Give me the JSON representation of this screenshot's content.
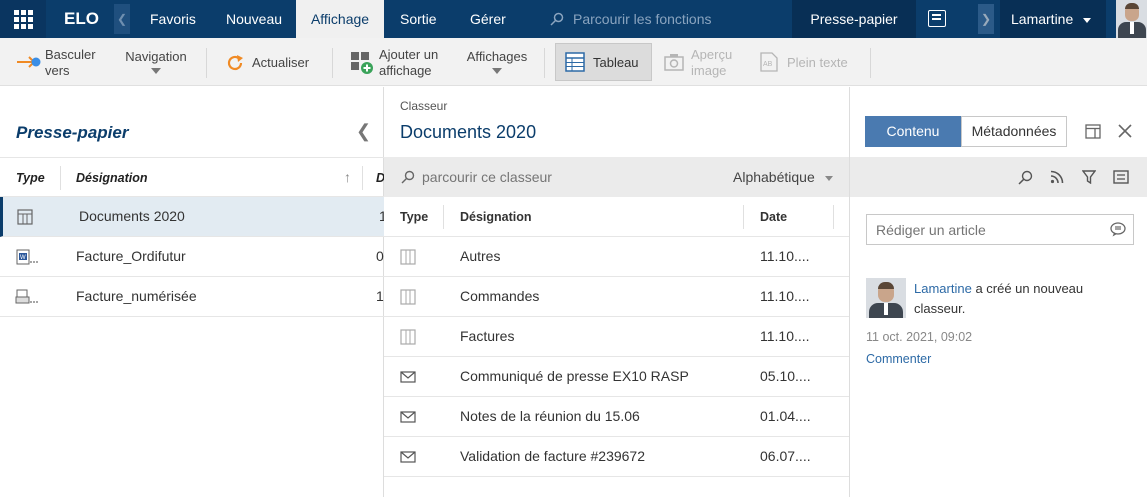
{
  "topbar": {
    "logo": "ELO",
    "tabs": [
      "Favoris",
      "Nouveau",
      "Affichage",
      "Sortie",
      "Gérer"
    ],
    "search_placeholder": "Parcourir les fonctions",
    "clipboard_label": "Presse-papier",
    "user_name": "Lamartine",
    "active_tab": "Affichage"
  },
  "ribbon": {
    "switch_line1": "Basculer",
    "switch_line2": "vers",
    "navigation": "Navigation",
    "refresh": "Actualiser",
    "add_view_line1": "Ajouter un",
    "add_view_line2": "affichage",
    "views": "Affichages",
    "table": "Tableau",
    "preview_line1": "Aperçu",
    "preview_line2": "image",
    "plaintext": "Plein texte"
  },
  "left_panel": {
    "title": "Presse-papier",
    "col_type": "Type",
    "col_designation": "Désignation",
    "col_extra": "D",
    "rows": [
      {
        "name": "Documents 2020",
        "extra": "1",
        "icon": "folder-icon",
        "selected": true
      },
      {
        "name": "Facture_Ordifutur",
        "extra": "0",
        "icon": "word-document-icon",
        "selected": false
      },
      {
        "name": "Facture_numérisée",
        "extra": "1",
        "icon": "scanned-document-icon",
        "selected": false
      }
    ]
  },
  "center_panel": {
    "subtitle": "Classeur",
    "title": "Documents 2020",
    "search_placeholder": "parcourir ce classeur",
    "sort_label": "Alphabétique",
    "col_type": "Type",
    "col_designation": "Désignation",
    "col_date": "Date",
    "rows": [
      {
        "name": "Autres",
        "date": "11.10....",
        "icon": "folder-icon"
      },
      {
        "name": "Commandes",
        "date": "11.10....",
        "icon": "folder-icon"
      },
      {
        "name": "Factures",
        "date": "11.10....",
        "icon": "folder-icon"
      },
      {
        "name": "Communiqué de presse EX10 RASP",
        "date": "05.10....",
        "icon": "email-icon"
      },
      {
        "name": "Notes de la réunion du 15.06",
        "date": "01.04....",
        "icon": "email-icon"
      },
      {
        "name": "Validation de facture #239672",
        "date": "06.07....",
        "icon": "email-icon"
      }
    ]
  },
  "right_panel": {
    "tab_content": "Contenu",
    "tab_metadata": "Métadonnées",
    "article_placeholder": "Rédiger un article",
    "feed": {
      "user": "Lamartine",
      "text": "a créé un nouveau",
      "text2": "classeur.",
      "timestamp": "11 oct. 2021, 09:02",
      "comment": "Commenter"
    }
  },
  "colors": {
    "topbar": "#0b3d6b",
    "accent": "#4a7ab0",
    "selected_row": "#e2ebf2"
  }
}
